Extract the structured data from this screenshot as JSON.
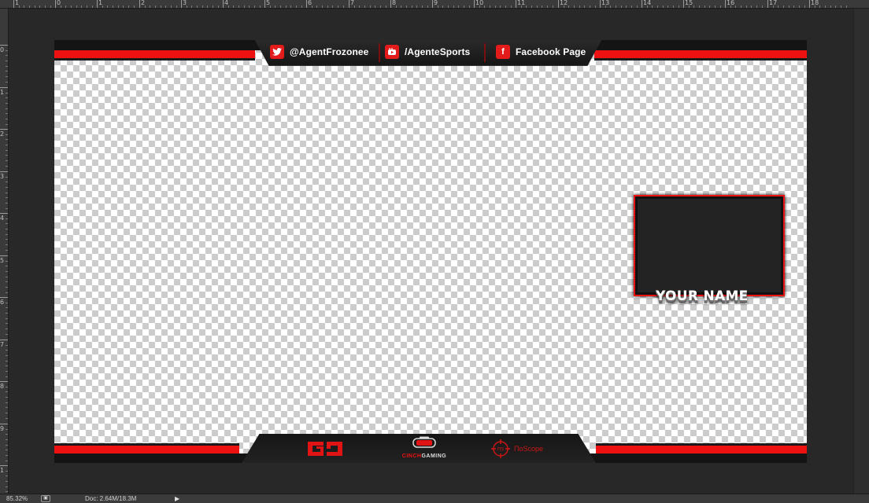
{
  "ruler": {
    "top_labels": [
      "1",
      "0",
      "1",
      "2",
      "3",
      "4",
      "5",
      "6",
      "7",
      "8",
      "9",
      "10",
      "11",
      "12",
      "13",
      "14",
      "15",
      "16",
      "17",
      "18"
    ],
    "left_labels": [
      "0",
      "1",
      "2",
      "3",
      "4",
      "5",
      "6",
      "7",
      "8",
      "9",
      "1"
    ]
  },
  "overlay": {
    "social": [
      {
        "icon": "twitter-icon",
        "glyph": "🐦",
        "label": "@AgentFrozonee"
      },
      {
        "icon": "youtube-icon",
        "glyph": "▶",
        "label": "/AgenteSports"
      },
      {
        "icon": "facebook-icon",
        "glyph": "f",
        "label": "Facebook Page"
      }
    ],
    "webcam_name": "YOUR NAME",
    "logo_cinch_word": "CINCH",
    "logo_cinch_word2": "GAMING",
    "logo_noscope_badge": "ΠS",
    "logo_noscope_word": "ΠoScope",
    "colors": {
      "accent": "#ee1111",
      "dark": "#141414"
    }
  },
  "statusbar": {
    "zoom": "85.32%",
    "doc": "Doc: 2.64M/18.3M",
    "menu_arrow": "▶"
  }
}
